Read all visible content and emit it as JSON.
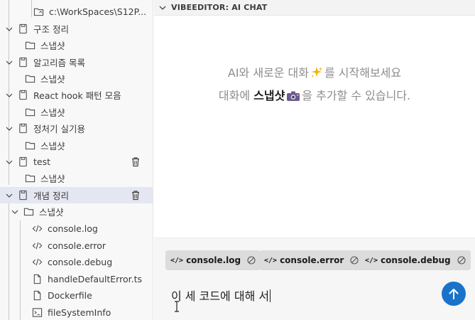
{
  "sidebar": {
    "top_path": "c:\\WorkSpaces\\S12P...",
    "groups": [
      {
        "name": "구조 정리",
        "child": "스냅샷",
        "has_trash": false
      },
      {
        "name": "알고리즘 목록",
        "child": "스냅샷",
        "has_trash": false
      },
      {
        "name": "React hook 패턴 모음",
        "child": "스냅샷",
        "has_trash": false
      },
      {
        "name": "정처기 실기용",
        "child": "스냅샷",
        "has_trash": false
      },
      {
        "name": "test",
        "child": "스냅샷",
        "has_trash": true
      },
      {
        "name": "개념 정리",
        "child": "스냅샷",
        "has_trash": true,
        "selected": true
      }
    ],
    "files": [
      {
        "name": "console.log",
        "icon": "code-icon"
      },
      {
        "name": "console.error",
        "icon": "code-icon"
      },
      {
        "name": "console.debug",
        "icon": "code-icon"
      },
      {
        "name": "handleDefaultError.ts",
        "icon": "file-icon"
      },
      {
        "name": "Dockerfile",
        "icon": "file-icon"
      },
      {
        "name": "fileSystemInfo",
        "icon": "terminal-icon"
      }
    ]
  },
  "chat": {
    "title": "VIBEEDITOR: AI CHAT",
    "welcome": {
      "line1_before": "AI와 새로운 대화",
      "line1_emoji": "sparkles-emoji",
      "line1_after": "를 시작해보세요",
      "line2_before": "대화에 ",
      "line2_bold": "스냅샷",
      "line2_emoji": "camera-emoji",
      "line2_after": "을 추가할 수 있습니다."
    },
    "chips": [
      {
        "label": "console.log"
      },
      {
        "label": "console.error"
      },
      {
        "label": "console.debug"
      }
    ],
    "input_value": "이 세 코드에 대해 서",
    "send_icon": "arrow-up-icon"
  },
  "colors": {
    "accent": "#1a73c9",
    "selected_row": "#e4e6f1",
    "muted_text": "#8d8d8d",
    "chip_bg": "#dcdcdc"
  }
}
